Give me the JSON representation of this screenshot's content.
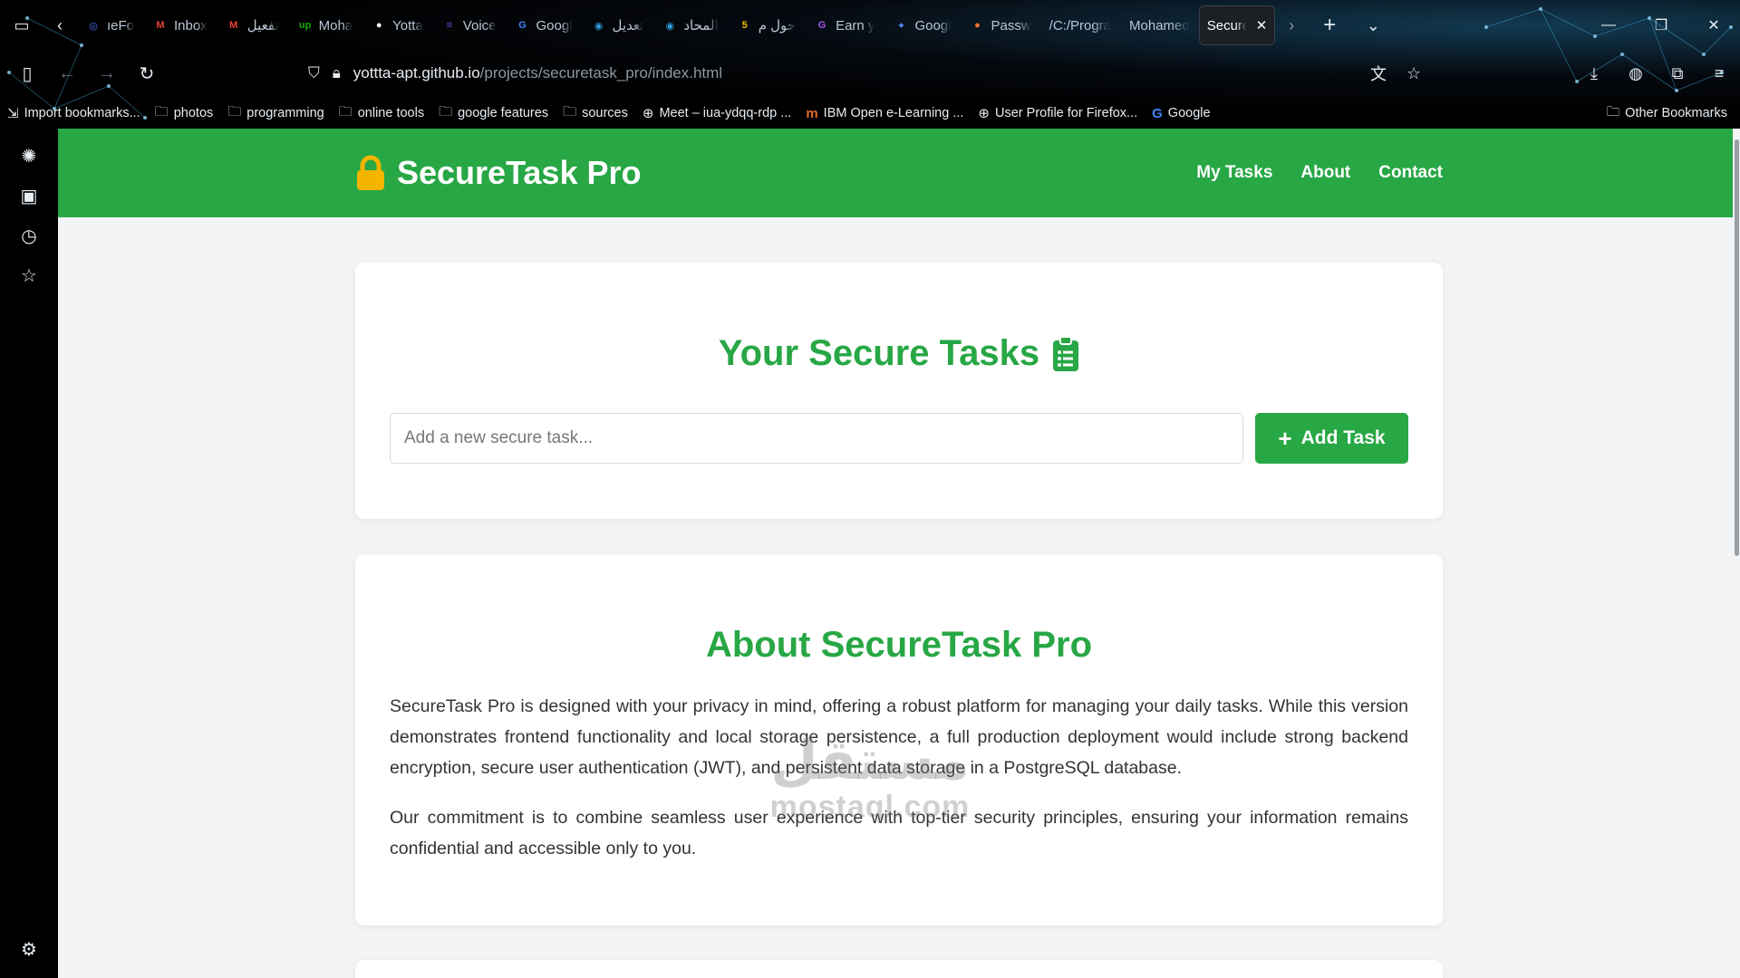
{
  "browser": {
    "tabs": [
      {
        "title": "ıeFo",
        "icon": "firefox-view-icon",
        "color": "#4a6cf7"
      },
      {
        "title": "Inbox",
        "icon": "gmail-icon",
        "color": "#ea4335"
      },
      {
        "title": "تفعيل",
        "icon": "gmail-icon",
        "color": "#ea4335"
      },
      {
        "title": "Moha",
        "icon": "upwork-icon",
        "color": "#14a800"
      },
      {
        "title": "Yotta",
        "icon": "github-icon",
        "color": "#ffffff"
      },
      {
        "title": "Voice",
        "icon": "notes-icon",
        "color": "#7b4fe0"
      },
      {
        "title": "Googl",
        "icon": "google-translate-icon",
        "color": "#4285f4"
      },
      {
        "title": "تعديل",
        "icon": "circle-icon",
        "color": "#2d9cdb"
      },
      {
        "title": "المحاد",
        "icon": "circle-icon",
        "color": "#2d9cdb"
      },
      {
        "title": "حول م",
        "icon": "five-icon",
        "color": "#f2b705"
      },
      {
        "title": "Earn y",
        "icon": "g-icon",
        "color": "#a855f7"
      },
      {
        "title": "Googl",
        "icon": "gemini-icon",
        "color": "#4f8cf7"
      },
      {
        "title": "Passw",
        "icon": "firefox-icon",
        "color": "#ff7139"
      },
      {
        "title": "/C:/Progra",
        "icon": "",
        "color": ""
      },
      {
        "title": "Mohamed",
        "icon": "",
        "color": ""
      }
    ],
    "active_tab": {
      "title": "SecureT"
    },
    "url_host": "yottta-apt.github.io",
    "url_path": "/projects/securetask_pro/index.html",
    "bookmarks": [
      {
        "label": "Import bookmarks...",
        "icon": "import-icon"
      },
      {
        "label": "photos",
        "icon": "folder-icon"
      },
      {
        "label": "programming",
        "icon": "folder-icon"
      },
      {
        "label": "online tools",
        "icon": "folder-icon"
      },
      {
        "label": "google features",
        "icon": "folder-icon"
      },
      {
        "label": "sources",
        "icon": "folder-icon"
      },
      {
        "label": "Meet – iua-ydqq-rdp ...",
        "icon": "globe-icon"
      },
      {
        "label": "IBM Open e-Learning ...",
        "icon": "ibm-icon"
      },
      {
        "label": "User Profile for Firefox...",
        "icon": "globe-icon"
      },
      {
        "label": "Google",
        "icon": "google-icon"
      }
    ],
    "other_bookmarks": "Other Bookmarks"
  },
  "site": {
    "brand": "SecureTask Pro",
    "nav": [
      "My Tasks",
      "About",
      "Contact"
    ],
    "accent": "#28a745"
  },
  "tasks_card": {
    "title": "Your Secure Tasks",
    "input_placeholder": "Add a new secure task...",
    "add_button": "Add Task"
  },
  "about_card": {
    "title": "About SecureTask Pro",
    "paragraph1": "SecureTask Pro is designed with your privacy in mind, offering a robust platform for managing your daily tasks. While this version demonstrates frontend functionality and local storage persistence, a full production deployment would include strong backend encryption, secure user authentication (JWT), and persistent data storage in a PostgreSQL database.",
    "paragraph2": "Our commitment is to combine seamless user experience with top-tier security principles, ensuring your information remains confidential and accessible only to you."
  },
  "watermark": {
    "logo": "مستقل",
    "domain": "mostaql.com"
  }
}
